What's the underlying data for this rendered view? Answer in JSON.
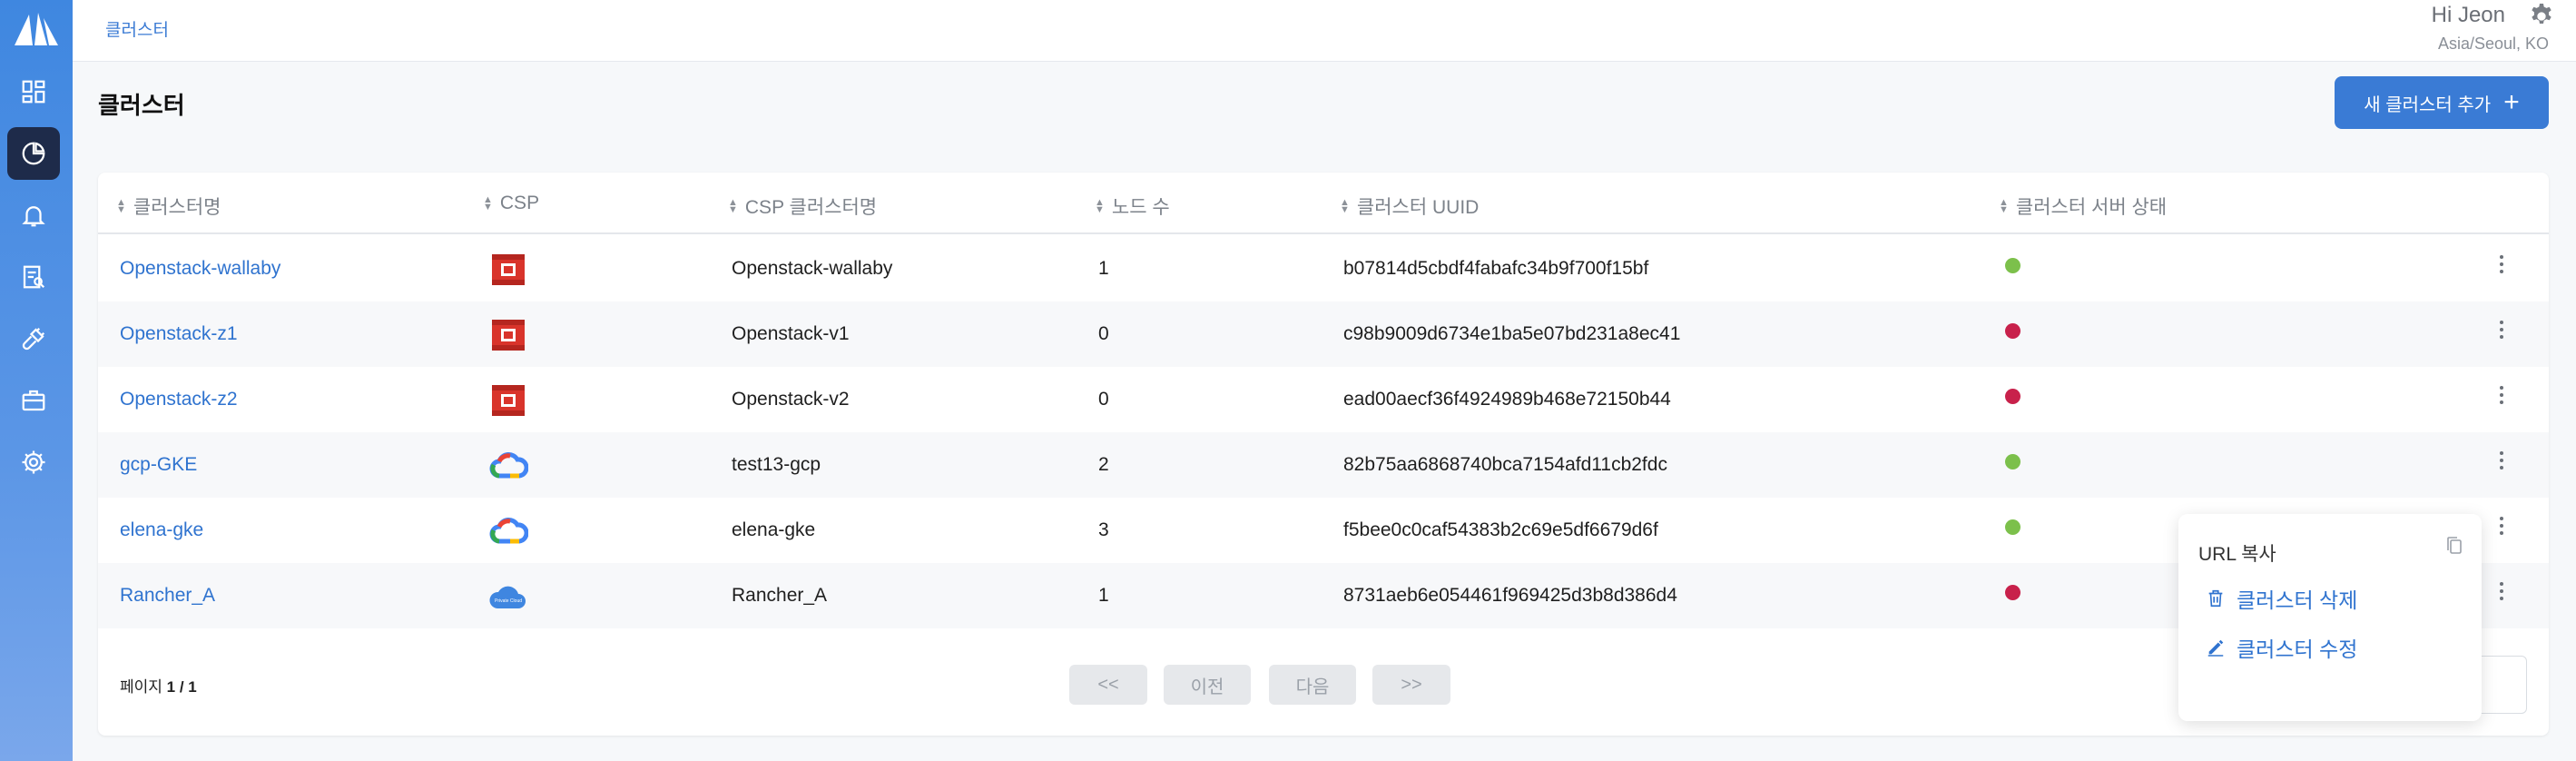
{
  "breadcrumb": "클러스터",
  "user": {
    "greeting": "Hi Jeon",
    "timezone": "Asia/Seoul, KO"
  },
  "page": {
    "title": "클러스터",
    "add_button": "새 클러스터 추가",
    "add_icon": "+"
  },
  "table": {
    "headers": [
      "클러스터명",
      "CSP",
      "CSP 클러스터명",
      "노드 수",
      "클러스터 UUID",
      "클러스터 서버 상태"
    ],
    "rows": [
      {
        "name": "Openstack-wallaby",
        "csp": "openstack-icon",
        "csp_cluster": "Openstack-wallaby",
        "nodes": "1",
        "uuid": "b07814d5cbdf4fabafc34b9f700f15bf",
        "status": "online"
      },
      {
        "name": "Openstack-z1",
        "csp": "openstack-icon",
        "csp_cluster": "Openstack-v1",
        "nodes": "0",
        "uuid": "c98b9009d6734e1ba5e07bd231a8ec41",
        "status": "offline"
      },
      {
        "name": "Openstack-z2",
        "csp": "openstack-icon",
        "csp_cluster": "Openstack-v2",
        "nodes": "0",
        "uuid": "ead00aecf36f4924989b468e72150b44",
        "status": "offline"
      },
      {
        "name": "gcp-GKE",
        "csp": "google-cloud-icon",
        "csp_cluster": "test13-gcp",
        "nodes": "2",
        "uuid": "82b75aa6868740bca7154afd11cb2fdc",
        "status": "online"
      },
      {
        "name": "elena-gke",
        "csp": "google-cloud-icon",
        "csp_cluster": "elena-gke",
        "nodes": "3",
        "uuid": "f5bee0c0caf54383b2c69e5df6679d6f",
        "status": "online"
      },
      {
        "name": "Rancher_A",
        "csp": "private-cloud-icon",
        "csp_cluster": "Rancher_A",
        "nodes": "1",
        "uuid": "8731aeb6e054461f969425d3b8d386d4",
        "status": "offline"
      }
    ]
  },
  "private_cloud_label": "Private Cloud",
  "pagination": {
    "label": "페이지",
    "current": "1 / 1",
    "first": "<<",
    "prev": "이전",
    "next": "다음",
    "last": ">>"
  },
  "menu": {
    "copy_url": "URL 복사",
    "delete": "클러스터 삭제",
    "edit": "클러스터 수정"
  },
  "colors": {
    "online": "#7cc04b",
    "offline": "#c8214b",
    "accent": "#3a7bd5",
    "sidebar": "#3f87e0",
    "active_nav": "#1e2b4a"
  },
  "sidebar": {
    "items": [
      "dashboard-icon",
      "cluster-icon",
      "bell-icon",
      "report-icon",
      "plug-icon",
      "briefcase-icon",
      "gear-icon"
    ]
  }
}
